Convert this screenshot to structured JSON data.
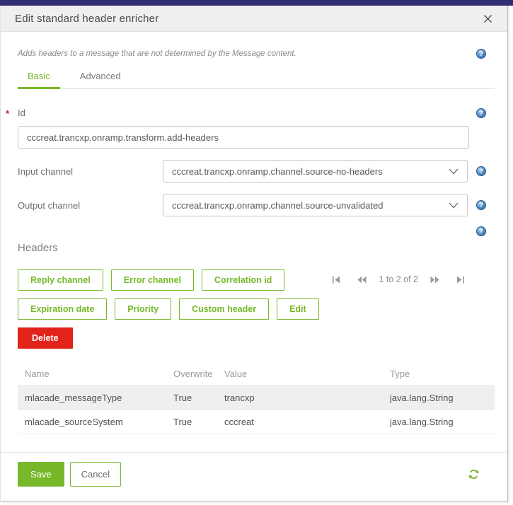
{
  "modal": {
    "title": "Edit standard header enricher",
    "description": "Adds headers to a message that are not determined by the Message content."
  },
  "tabs": [
    {
      "label": "Basic",
      "active": true
    },
    {
      "label": "Advanced",
      "active": false
    }
  ],
  "form": {
    "id_field": {
      "label": "Id",
      "required_marker": "*",
      "value": "cccreat.trancxp.onramp.transform.add-headers"
    },
    "input_channel": {
      "label": "Input channel",
      "value": "cccreat.trancxp.onramp.channel.source-no-headers"
    },
    "output_channel": {
      "label": "Output channel",
      "value": "cccreat.trancxp.onramp.channel.source-unvalidated"
    }
  },
  "headers_section": {
    "title": "Headers",
    "buttons": [
      "Reply channel",
      "Error channel",
      "Correlation id",
      "Expiration date",
      "Priority",
      "Custom header",
      "Edit"
    ],
    "delete_button": "Delete",
    "pagination": {
      "text": "1 to 2 of 2"
    },
    "table": {
      "columns": [
        "Name",
        "Overwrite",
        "Value",
        "Type"
      ],
      "rows": [
        {
          "name": "mlacade_messageType",
          "overwrite": "True",
          "value": "trancxp",
          "type": "java.lang.String"
        },
        {
          "name": "mlacade_sourceSystem",
          "overwrite": "True",
          "value": "cccreat",
          "type": "java.lang.String"
        }
      ]
    }
  },
  "footer": {
    "save_label": "Save",
    "cancel_label": "Cancel"
  },
  "icons": {
    "help": "?",
    "question_tooltip": "help-icon"
  },
  "colors": {
    "accent_green": "#76b82a",
    "delete_red": "#e2231a",
    "top_bar_purple": "#312e74",
    "help_blue": "#3e75b0",
    "selected_row": "#efeef0"
  }
}
